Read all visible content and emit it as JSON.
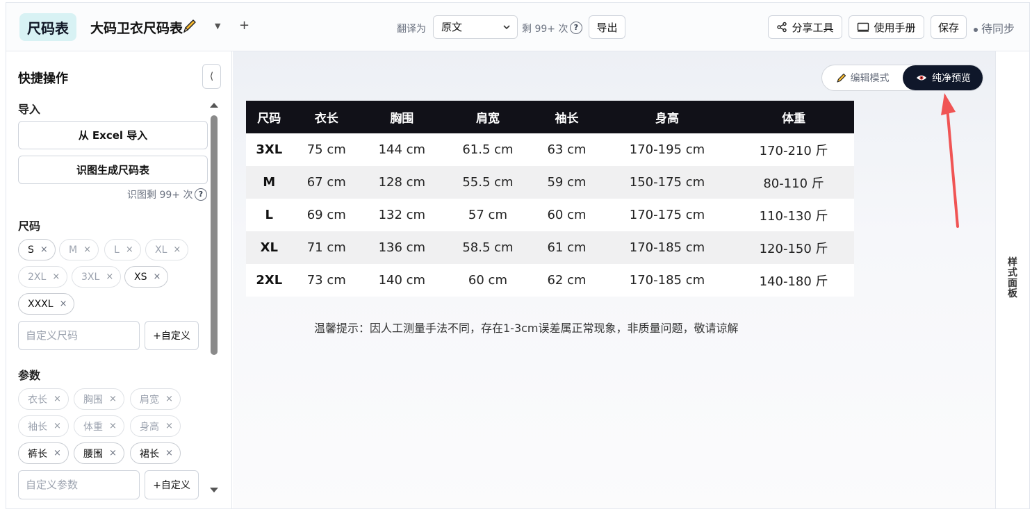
{
  "header": {
    "logo": "尺码表",
    "doc_title": "大码卫衣尺码表",
    "translate_label": "翻译为",
    "translate_value": "原文",
    "remaining": "剩 99+ 次",
    "help": "?",
    "export": "导出",
    "share": "分享工具",
    "manual": "使用手册",
    "save": "保存",
    "sync_status": "待同步"
  },
  "sidebar": {
    "title": "快捷操作",
    "collapse": "⟨",
    "import_label": "导入",
    "excel_import": "从 Excel 导入",
    "ocr_generate": "识图生成尺码表",
    "ocr_remaining": "识图剩 99+ 次",
    "size_label": "尺码",
    "sizes": [
      {
        "label": "S",
        "active": true
      },
      {
        "label": "M",
        "active": false
      },
      {
        "label": "L",
        "active": false
      },
      {
        "label": "XL",
        "active": false
      },
      {
        "label": "2XL",
        "active": false
      },
      {
        "label": "3XL",
        "active": false
      },
      {
        "label": "XS",
        "active": true
      },
      {
        "label": "XXXL",
        "active": true
      }
    ],
    "custom_size_placeholder": "自定义尺码",
    "custom_button": "+自定义",
    "param_label": "参数",
    "params": [
      {
        "label": "衣长",
        "active": false
      },
      {
        "label": "胸围",
        "active": false
      },
      {
        "label": "肩宽",
        "active": false
      },
      {
        "label": "袖长",
        "active": false
      },
      {
        "label": "体重",
        "active": false
      },
      {
        "label": "身高",
        "active": false
      },
      {
        "label": "裤长",
        "active": true
      },
      {
        "label": "腰围",
        "active": true
      },
      {
        "label": "裙长",
        "active": true
      }
    ],
    "custom_param_placeholder": "自定义参数"
  },
  "main": {
    "mode_edit": "编辑模式",
    "mode_preview": "纯净预览",
    "table": {
      "headers": [
        "尺码",
        "衣长",
        "胸围",
        "肩宽",
        "袖长",
        "身高",
        "体重"
      ],
      "rows": [
        [
          "3XL",
          "75 cm",
          "144 cm",
          "61.5 cm",
          "63 cm",
          "170-195 cm",
          "170-210 斤"
        ],
        [
          "M",
          "67 cm",
          "128 cm",
          "55.5 cm",
          "59 cm",
          "150-175 cm",
          "80-110 斤"
        ],
        [
          "L",
          "69 cm",
          "132 cm",
          "57 cm",
          "60 cm",
          "170-175 cm",
          "110-130 斤"
        ],
        [
          "XL",
          "71 cm",
          "136 cm",
          "58.5 cm",
          "61 cm",
          "170-185 cm",
          "120-150 斤"
        ],
        [
          "2XL",
          "73 cm",
          "140 cm",
          "60 cm",
          "62 cm",
          "170-185 cm",
          "140-180 斤"
        ]
      ]
    },
    "tip": "温馨提示：因人工测量手法不同，存在1-3cm误差属正常现象，非质量问题，敬请谅解"
  },
  "right_panel": {
    "label": "样式面板"
  },
  "colors": {
    "accent": "#0f172a",
    "logo_bg": "#d8f2f4",
    "annotation_arrow": "#f05454"
  }
}
